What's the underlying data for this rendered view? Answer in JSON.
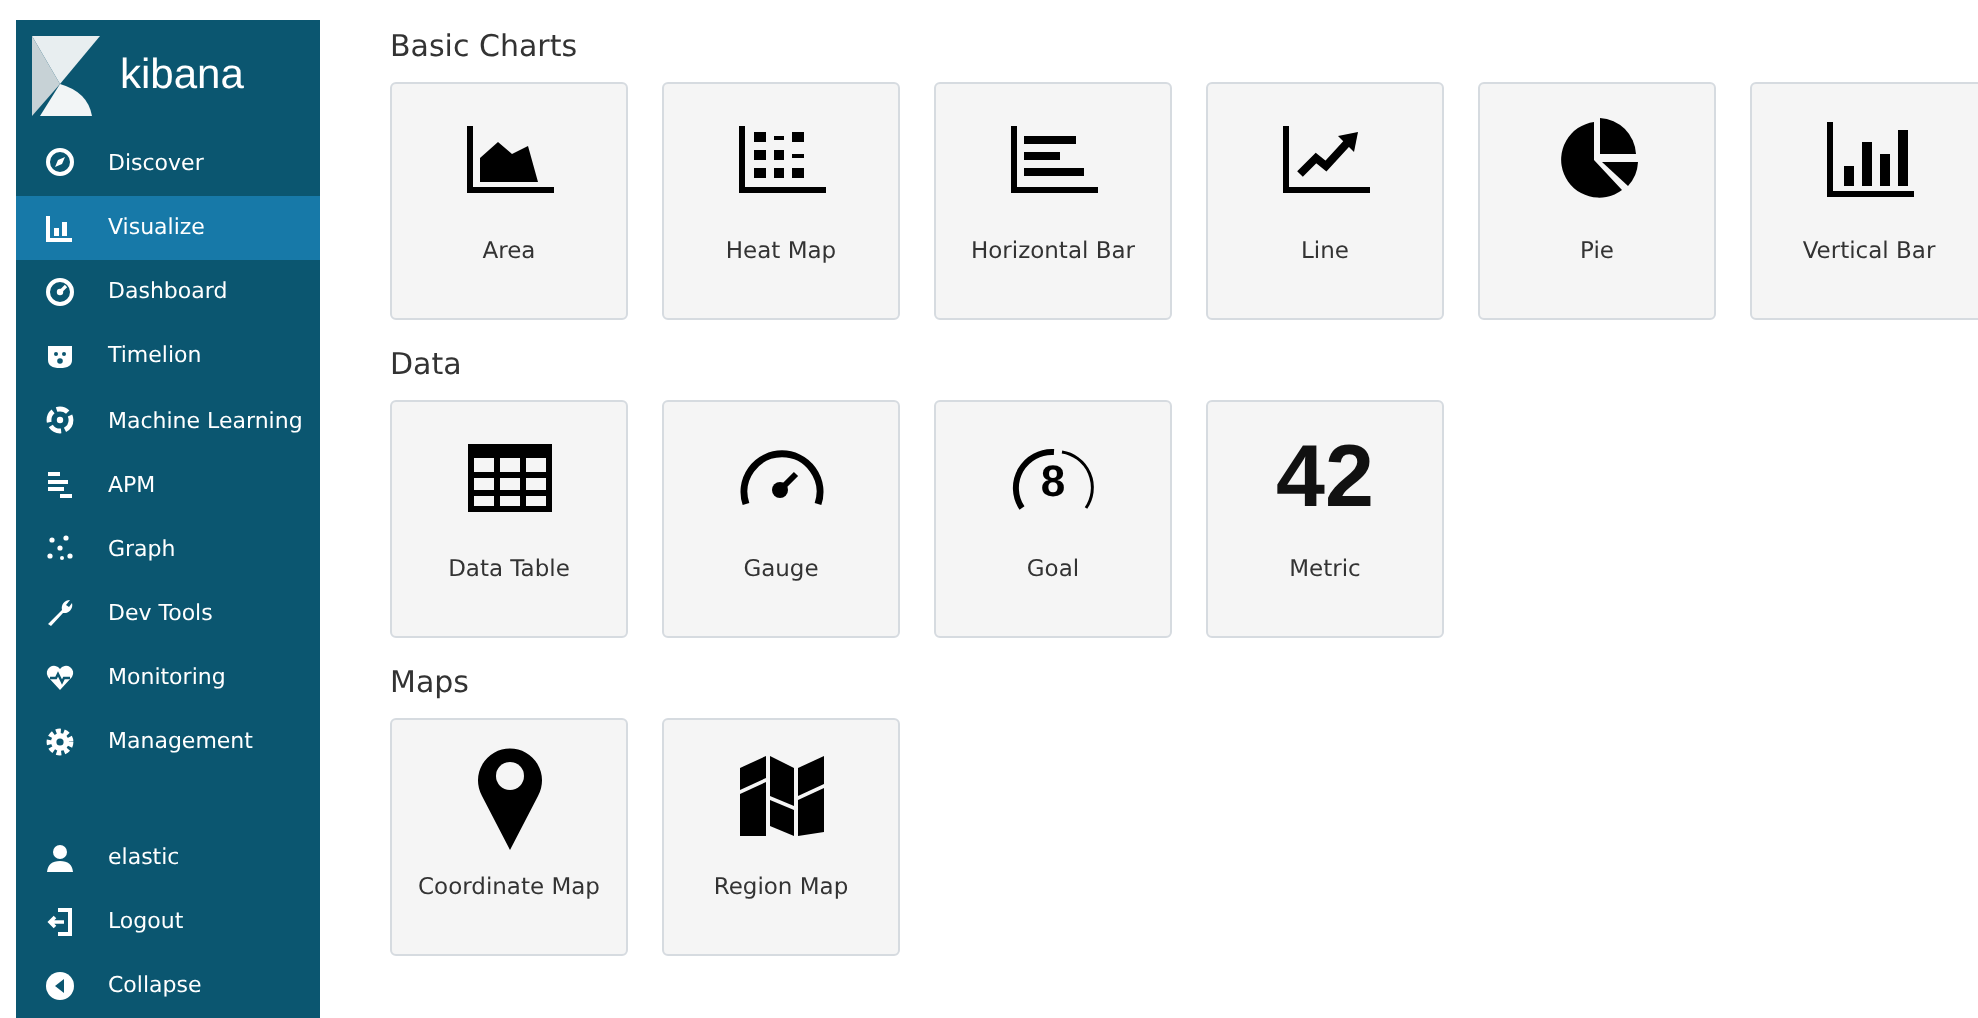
{
  "sidebar": {
    "logo": "kibana",
    "items": [
      {
        "label": "Discover",
        "kind": "compass",
        "selected": false
      },
      {
        "label": "Visualize",
        "kind": "barchart",
        "selected": true
      },
      {
        "label": "Dashboard",
        "kind": "dashboard",
        "selected": false
      },
      {
        "label": "Timelion",
        "kind": "bear",
        "selected": false
      },
      {
        "label": "Machine Learning",
        "kind": "ml",
        "selected": false
      },
      {
        "label": "APM",
        "kind": "apm",
        "selected": false
      },
      {
        "label": "Graph",
        "kind": "graph",
        "selected": false
      },
      {
        "label": "Dev Tools",
        "kind": "wrench",
        "selected": false
      },
      {
        "label": "Monitoring",
        "kind": "heart",
        "selected": false
      },
      {
        "label": "Management",
        "kind": "gear",
        "selected": false
      }
    ],
    "bottom_items": [
      {
        "label": "elastic",
        "kind": "user",
        "selected": false
      },
      {
        "label": "Logout",
        "kind": "logout",
        "selected": false
      },
      {
        "label": "Collapse",
        "kind": "collapse",
        "selected": false
      }
    ]
  },
  "sections": [
    {
      "title": "Basic Charts",
      "cards": [
        {
          "label": "Area",
          "kind": "area"
        },
        {
          "label": "Heat Map",
          "kind": "heatmap"
        },
        {
          "label": "Horizontal Bar",
          "kind": "hbar"
        },
        {
          "label": "Line",
          "kind": "line"
        },
        {
          "label": "Pie",
          "kind": "pie"
        },
        {
          "label": "Vertical Bar",
          "kind": "vbar"
        }
      ]
    },
    {
      "title": "Data",
      "cards": [
        {
          "label": "Data Table",
          "kind": "table"
        },
        {
          "label": "Gauge",
          "kind": "gauge"
        },
        {
          "label": "Goal",
          "kind": "goal",
          "icon_text": "8"
        },
        {
          "label": "Metric",
          "kind": "metric",
          "icon_text": "42"
        }
      ]
    },
    {
      "title": "Maps",
      "cards": [
        {
          "label": "Coordinate Map",
          "kind": "pin"
        },
        {
          "label": "Region Map",
          "kind": "map"
        }
      ]
    }
  ]
}
